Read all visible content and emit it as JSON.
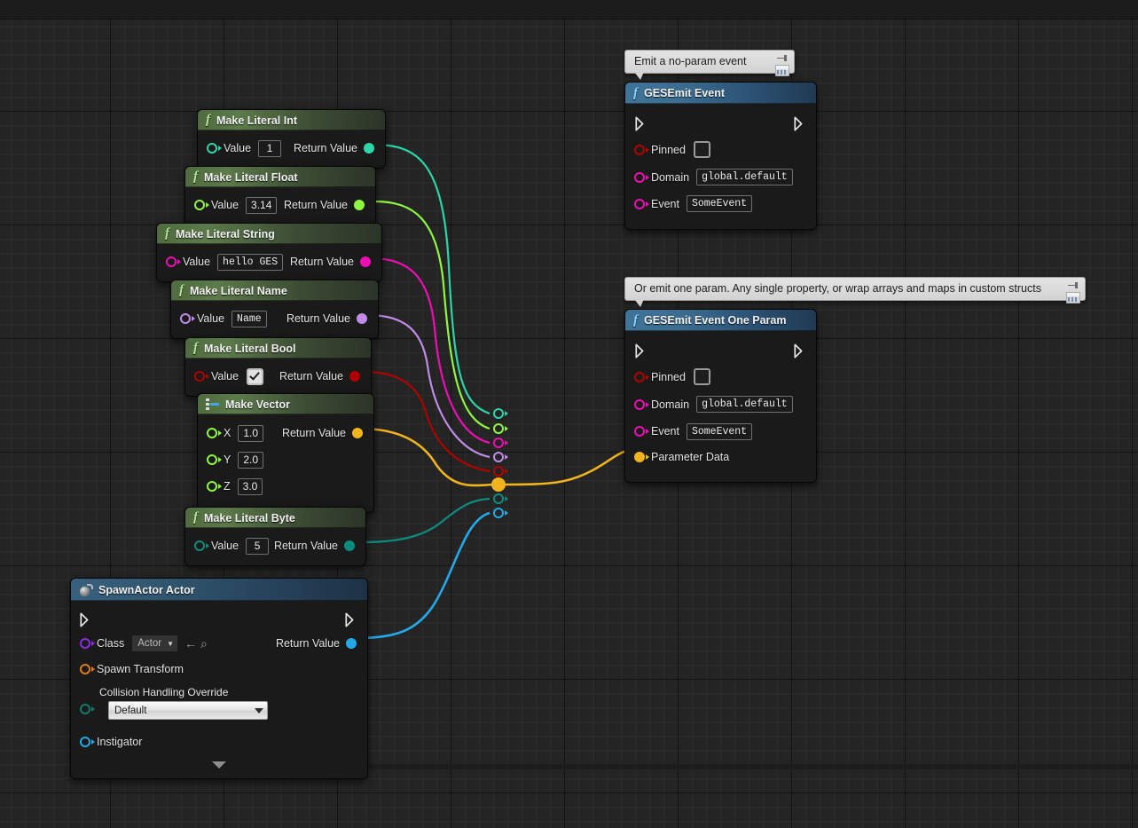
{
  "app": {
    "context": "unreal-blueprint-graph",
    "background_color": "#242424",
    "grid_minor_color": "#2a2a2a",
    "grid_major_color": "#111111"
  },
  "comments": [
    {
      "id": "comment-no-param",
      "text": "Emit a no-param event",
      "pin_icon": "pushpin-icon",
      "note_icon": "note-icon"
    },
    {
      "id": "comment-one-param",
      "text": "Or emit one param. Any single property, or wrap arrays and maps in custom structs",
      "pin_icon": "pushpin-icon",
      "note_icon": "note-icon"
    }
  ],
  "nodes": {
    "make_literal_int": {
      "title": "Make Literal Int",
      "icon": "function-icon",
      "input_label": "Value",
      "input_value": "1",
      "output_label": "Return Value",
      "pin_color": "#2ed5a6"
    },
    "make_literal_float": {
      "title": "Make Literal Float",
      "icon": "function-icon",
      "input_label": "Value",
      "input_value": "3.14",
      "output_label": "Return Value",
      "pin_color": "#8ef73f"
    },
    "make_literal_string": {
      "title": "Make Literal String",
      "icon": "function-icon",
      "input_label": "Value",
      "input_value": "hello GES",
      "output_label": "Return Value",
      "pin_color": "#ee0fb4"
    },
    "make_literal_name": {
      "title": "Make Literal Name",
      "icon": "function-icon",
      "input_label": "Value",
      "input_value": "Name",
      "output_label": "Return Value",
      "pin_color": "#c08ce8"
    },
    "make_literal_bool": {
      "title": "Make Literal Bool",
      "icon": "function-icon",
      "input_label": "Value",
      "input_value": "true",
      "output_label": "Return Value",
      "pin_color": "#b00000"
    },
    "make_vector": {
      "title": "Make Vector",
      "icon": "make-struct-icon",
      "inputs": [
        {
          "label": "X",
          "value": "1.0"
        },
        {
          "label": "Y",
          "value": "2.0"
        },
        {
          "label": "Z",
          "value": "3.0"
        }
      ],
      "output_label": "Return Value",
      "pin_color": "#f1b41c",
      "input_pin_color": "#8ef73f"
    },
    "make_literal_byte": {
      "title": "Make Literal Byte",
      "icon": "function-icon",
      "input_label": "Value",
      "input_value": "5",
      "output_label": "Return Value",
      "pin_color": "#0c8c7e"
    },
    "spawn_actor": {
      "title": "SpawnActor Actor",
      "icon": "actor-icon",
      "class_label": "Class",
      "class_value": "Actor",
      "class_pin_color": "#8a2be2",
      "browse_icon": "browse-back-icon",
      "find_icon": "magnifier-icon",
      "spawn_transform_label": "Spawn Transform",
      "spawn_transform_pin_color": "#e07b12",
      "collision_label": "Collision Handling Override",
      "collision_value": "Default",
      "collision_pin_color": "#0f7a6e",
      "instigator_label": "Instigator",
      "instigator_pin_color": "#24a9e8",
      "output_label": "Return Value",
      "output_pin_color": "#24a9e8",
      "expander_icon": "chevron-down-icon"
    },
    "ges_emit_event": {
      "title": "GESEmit Event",
      "icon": "function-icon",
      "rows": [
        {
          "label": "Pinned",
          "widget": "checkbox",
          "value": "false",
          "pin_color": "#b00000"
        },
        {
          "label": "Domain",
          "widget": "textbox",
          "value": "global.default",
          "pin_color": "#ee0fb4"
        },
        {
          "label": "Event",
          "widget": "textbox",
          "value": "SomeEvent",
          "pin_color": "#ee0fb4"
        }
      ],
      "exec_in_icon": "exec-pin-icon",
      "exec_out_icon": "exec-pin-icon"
    },
    "ges_emit_event_one_param": {
      "title": "GESEmit Event One Param",
      "icon": "function-icon",
      "rows": [
        {
          "label": "Pinned",
          "widget": "checkbox",
          "value": "false",
          "pin_color": "#b00000"
        },
        {
          "label": "Domain",
          "widget": "textbox",
          "value": "global.default",
          "pin_color": "#ee0fb4"
        },
        {
          "label": "Event",
          "widget": "textbox",
          "value": "SomeEvent",
          "pin_color": "#ee0fb4"
        },
        {
          "label": "Parameter Data",
          "widget": "none",
          "value": "",
          "pin_color": "#f1b41c"
        }
      ],
      "exec_in_icon": "exec-pin-icon",
      "exec_out_icon": "exec-pin-icon"
    }
  },
  "wire_stubs": [
    {
      "name": "stub-int",
      "color": "#2ed5a6"
    },
    {
      "name": "stub-float",
      "color": "#8ef73f"
    },
    {
      "name": "stub-string",
      "color": "#ee0fb4"
    },
    {
      "name": "stub-name",
      "color": "#c08ce8"
    },
    {
      "name": "stub-bool",
      "color": "#b00000"
    },
    {
      "name": "stub-vector",
      "color": "#f1b41c"
    },
    {
      "name": "stub-byte",
      "color": "#0c8c7e"
    },
    {
      "name": "stub-actor",
      "color": "#24a9e8"
    }
  ]
}
